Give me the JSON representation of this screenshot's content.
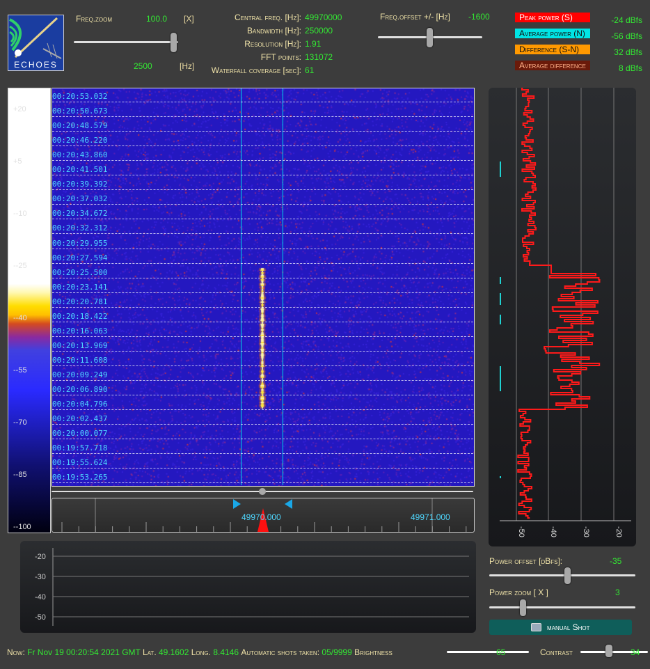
{
  "logo": {
    "text": "ECHOES"
  },
  "freq_zoom": {
    "label": "Freq.zoom",
    "value": "100.0",
    "unit": "[X]",
    "bottom_value": "2500",
    "bottom_unit": "[Hz]"
  },
  "info": {
    "central_freq": {
      "label": "Central freq. [Hz]:",
      "value": "49970000"
    },
    "bandwidth": {
      "label": "Bandwidth [Hz]:",
      "value": "250000"
    },
    "resolution": {
      "label": "Resolution [Hz]:",
      "value": "1.91"
    },
    "fft_points": {
      "label": "FFT points:",
      "value": "131072"
    },
    "waterfall": {
      "label": "Waterfall coverage [sec]:",
      "value": "61"
    }
  },
  "freq_offset": {
    "label": "Freq.offset +/- [Hz]",
    "value": "-1600"
  },
  "legend": {
    "peak": {
      "label": "Peak power (S)",
      "value": "-24 dBfs",
      "color": "#ff0000"
    },
    "avg": {
      "label": "Average power (N)",
      "value": "-56 dBfs",
      "color": "#00e5e5"
    },
    "diff": {
      "label": "Difference (S-N)",
      "value": "32 dBfs",
      "color": "#ff9900"
    },
    "avgdiff": {
      "label": "Average difference",
      "value": "8 dBfs",
      "color": "#6a1a0a"
    }
  },
  "color_scale": [
    "+20",
    "+5",
    "--10",
    "--25",
    "--40",
    "--55",
    "--70",
    "--85",
    "--100"
  ],
  "timestamps": [
    "00:20:53.032",
    "00:20:50.673",
    "00:20:48.579",
    "00:20:46.220",
    "00:20:43.860",
    "00:20:41.501",
    "00:20:39.392",
    "00:20:37.032",
    "00:20:34.672",
    "00:20:32.312",
    "00:20:29.955",
    "00:20:27.594",
    "00:20:25.500",
    "00:20:23.141",
    "00:20:20.781",
    "00:20:18.422",
    "00:20:16.063",
    "00:20:13.969",
    "00:20:11.608",
    "00:20:09.249",
    "00:20:06.890",
    "00:20:04.796",
    "00:20:02.437",
    "00:20:00.077",
    "00:19:57.718",
    "00:19:55.624",
    "00:19:53.265"
  ],
  "freq_axis": {
    "left_label": "49970.000",
    "right_label": "49971.000"
  },
  "power_axis": [
    "-50",
    "-40",
    "-30",
    "-20"
  ],
  "bottom_axis": [
    "-20",
    "-30",
    "-40",
    "-50"
  ],
  "power_offset": {
    "label": "Power offset [dBfs]:",
    "value": "-35"
  },
  "power_zoom": {
    "label": "Power zoom [ X ]",
    "value": "3"
  },
  "manual_shot": {
    "label": "manual Shot"
  },
  "status": {
    "now_label": "Now:",
    "now_value": "Fr Nov 19 00:20:54 2021 GMT",
    "lat_label": "Lat.",
    "lat_value": "49.1602",
    "long_label": "Long.",
    "long_value": "8.4146",
    "shots_label": "Automatic shots taken:",
    "shots_value": "05/9999",
    "brightness_label": "Brightness",
    "brightness_value": "65",
    "contrast_label": "Contrast",
    "contrast_value": "34"
  }
}
